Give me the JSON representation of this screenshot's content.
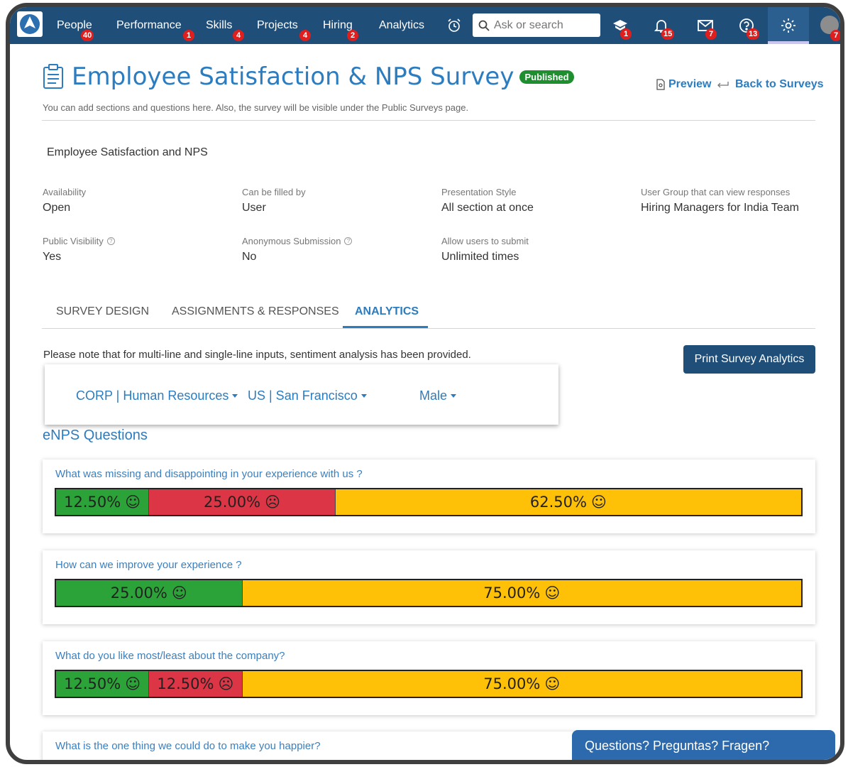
{
  "navbar": {
    "items": [
      {
        "label": "People",
        "badge": "40"
      },
      {
        "label": "Performance",
        "badge": "1"
      },
      {
        "label": "Skills",
        "badge": "4"
      },
      {
        "label": "Projects",
        "badge": "4"
      },
      {
        "label": "Hiring",
        "badge": "2"
      },
      {
        "label": "Analytics",
        "badge": ""
      }
    ],
    "search_placeholder": "Ask or search",
    "icon_badges": {
      "learning": "1",
      "notifications": "15",
      "messages": "7",
      "help": "13",
      "avatar": "7"
    },
    "colors": {
      "bar": "#1f4e79",
      "badge": "#e01e1e"
    }
  },
  "header": {
    "title": "Employee Satisfaction & NPS Survey",
    "status": "Published",
    "preview_label": "Preview",
    "back_label": "Back to Surveys",
    "subtitle": "You can add sections and questions here. Also, the survey will be visible under the Public Surveys page."
  },
  "survey_name": "Employee Satisfaction and NPS",
  "meta": {
    "availability": {
      "label": "Availability",
      "value": "Open"
    },
    "filled_by": {
      "label": "Can be filled by",
      "value": "User"
    },
    "presentation": {
      "label": "Presentation Style",
      "value": "All section at once"
    },
    "user_group": {
      "label": "User Group that can view responses",
      "value": "Hiring Managers for India Team"
    },
    "public_visibility": {
      "label": "Public Visibility",
      "value": "Yes"
    },
    "anonymous": {
      "label": "Anonymous Submission",
      "value": "No"
    },
    "allow_submit": {
      "label": "Allow users to submit",
      "value": "Unlimited times"
    }
  },
  "tabs": [
    "SURVEY DESIGN",
    "ASSIGNMENTS & RESPONSES",
    "ANALYTICS"
  ],
  "analytics": {
    "note": "Please note that for multi-line and single-line inputs, sentiment analysis has been provided.",
    "print_label": "Print Survey Analytics",
    "filters": [
      "CORP | Human Resources",
      "US | San Francisco",
      "Male"
    ],
    "section_title": "eNPS Questions",
    "colors": {
      "promoter": "#2ca338",
      "detractor": "#dc3545",
      "passive": "#ffc107"
    },
    "questions": [
      {
        "text": "What was missing and disappointing in your experience with us ?",
        "promoter": "12.50%",
        "detractor": "25.00%",
        "passive": "62.50%",
        "p": 12.5,
        "d": 25.0,
        "n": 62.5
      },
      {
        "text": "How can we improve your experience ?",
        "promoter": "25.00%",
        "detractor": "",
        "passive": "75.00%",
        "p": 25.0,
        "d": 0,
        "n": 75.0
      },
      {
        "text": "What do you like most/least about the company?",
        "promoter": "12.50%",
        "detractor": "12.50%",
        "passive": "75.00%",
        "p": 12.5,
        "d": 12.5,
        "n": 75.0
      },
      {
        "text": "What is the one thing we could do to make you happier?"
      }
    ]
  },
  "help_widget": "Questions? Preguntas? Fragen?"
}
